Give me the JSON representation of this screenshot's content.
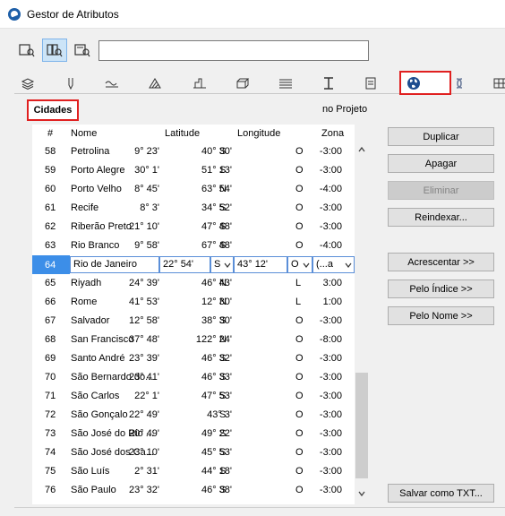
{
  "window": {
    "title": "Gestor de Atributos"
  },
  "search": {
    "value": ""
  },
  "section": {
    "label": "Cidades",
    "project_label": "no Projeto"
  },
  "table": {
    "headers": {
      "num": "#",
      "name": "Nome",
      "lat": "Latitude",
      "lon": "Longitude",
      "zone": "Zona"
    },
    "rows": [
      {
        "num": "58",
        "name": "Petrolina",
        "lat": "9° 23'",
        "ns": "S",
        "lon": "40° 30'",
        "eo": "O",
        "zone": "-3:00"
      },
      {
        "num": "59",
        "name": "Porto Alegre",
        "lat": "30° 1'",
        "ns": "S",
        "lon": "51° 13'",
        "eo": "O",
        "zone": "-3:00"
      },
      {
        "num": "60",
        "name": "Porto Velho",
        "lat": "8° 45'",
        "ns": "N",
        "lon": "63° 54'",
        "eo": "O",
        "zone": "-4:00"
      },
      {
        "num": "61",
        "name": "Recife",
        "lat": "8° 3'",
        "ns": "S",
        "lon": "34° 52'",
        "eo": "O",
        "zone": "-3:00"
      },
      {
        "num": "62",
        "name": "Riberão Preto",
        "lat": "21° 10'",
        "ns": "S",
        "lon": "47° 48'",
        "eo": "O",
        "zone": "-3:00"
      },
      {
        "num": "63",
        "name": "Rio Branco",
        "lat": "9° 58'",
        "ns": "S",
        "lon": "67° 48'",
        "eo": "O",
        "zone": "-4:00"
      },
      {
        "num": "64",
        "name": "Rio de Janeiro",
        "lat": "22° 54'",
        "ns": "S",
        "lon": "43° 12'",
        "eo": "O",
        "zone": "(...a",
        "selected": true
      },
      {
        "num": "65",
        "name": "Riyadh",
        "lat": "24° 39'",
        "ns": "N",
        "lon": "46° 43'",
        "eo": "L",
        "zone": "3:00"
      },
      {
        "num": "66",
        "name": "Rome",
        "lat": "41° 53'",
        "ns": "N",
        "lon": "12° 30'",
        "eo": "L",
        "zone": "1:00"
      },
      {
        "num": "67",
        "name": "Salvador",
        "lat": "12° 58'",
        "ns": "S",
        "lon": "38° 30'",
        "eo": "O",
        "zone": "-3:00"
      },
      {
        "num": "68",
        "name": "San Francisco",
        "lat": "37° 48'",
        "ns": "N",
        "lon": "122° 24'",
        "eo": "O",
        "zone": "-8:00"
      },
      {
        "num": "69",
        "name": "Santo André",
        "lat": "23° 39'",
        "ns": "S",
        "lon": "46° 32'",
        "eo": "O",
        "zone": "-3:00"
      },
      {
        "num": "70",
        "name": "São Bernardo do...",
        "lat": "23° 41'",
        "ns": "S",
        "lon": "46° 33'",
        "eo": "O",
        "zone": "-3:00"
      },
      {
        "num": "71",
        "name": "São Carlos",
        "lat": "22° 1'",
        "ns": "S",
        "lon": "47° 53'",
        "eo": "O",
        "zone": "-3:00"
      },
      {
        "num": "72",
        "name": "São Gonçalo",
        "lat": "22° 49'",
        "ns": "S",
        "lon": "43° 3'",
        "eo": "O",
        "zone": "-3:00"
      },
      {
        "num": "73",
        "name": "São José do Rio ...",
        "lat": "20° 49'",
        "ns": "S",
        "lon": "49° 22'",
        "eo": "O",
        "zone": "-3:00"
      },
      {
        "num": "74",
        "name": "São José dos Ca...",
        "lat": "23° 10'",
        "ns": "S",
        "lon": "45° 53'",
        "eo": "O",
        "zone": "-3:00"
      },
      {
        "num": "75",
        "name": "São Luís",
        "lat": "2° 31'",
        "ns": "S",
        "lon": "44° 18'",
        "eo": "O",
        "zone": "-3:00"
      },
      {
        "num": "76",
        "name": "São Paulo",
        "lat": "23° 32'",
        "ns": "S",
        "lon": "46° 38'",
        "eo": "O",
        "zone": "-3:00"
      }
    ]
  },
  "buttons": {
    "duplicate": "Duplicar",
    "clear": "Apagar",
    "delete": "Eliminar",
    "reindex": "Reindexar...",
    "append": "Acrescentar >>",
    "by_index": "Pelo Índice >>",
    "by_name": "Pelo Nome >>",
    "save_txt": "Salvar como TXT..."
  },
  "colors": {
    "highlight": "#e02020",
    "selection": "#3c8ee8",
    "globe": "#1e4d8f"
  }
}
